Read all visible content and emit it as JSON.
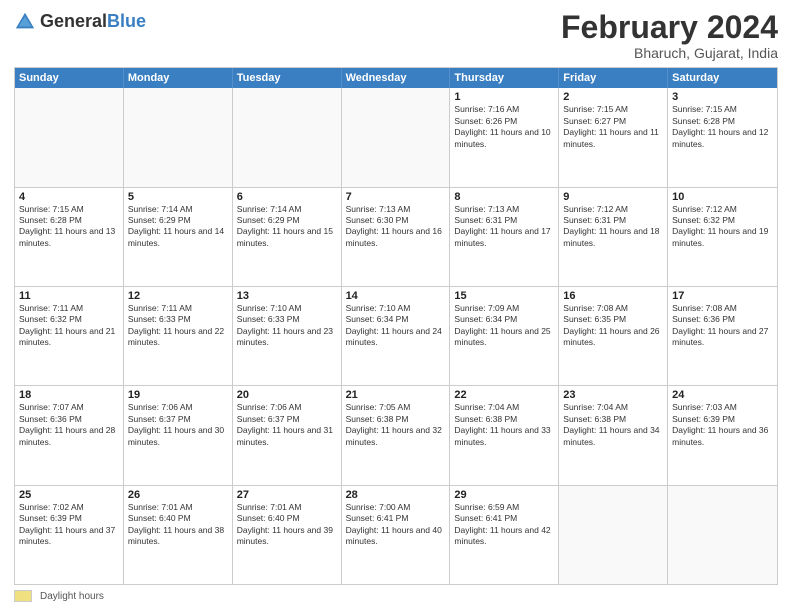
{
  "header": {
    "logo_general": "General",
    "logo_blue": "Blue",
    "month_year": "February 2024",
    "location": "Bharuch, Gujarat, India"
  },
  "calendar": {
    "days_of_week": [
      "Sunday",
      "Monday",
      "Tuesday",
      "Wednesday",
      "Thursday",
      "Friday",
      "Saturday"
    ],
    "footer_label": "Daylight hours",
    "weeks": [
      [
        {
          "day": "",
          "info": ""
        },
        {
          "day": "",
          "info": ""
        },
        {
          "day": "",
          "info": ""
        },
        {
          "day": "",
          "info": ""
        },
        {
          "day": "1",
          "info": "Sunrise: 7:16 AM\nSunset: 6:26 PM\nDaylight: 11 hours and 10 minutes."
        },
        {
          "day": "2",
          "info": "Sunrise: 7:15 AM\nSunset: 6:27 PM\nDaylight: 11 hours and 11 minutes."
        },
        {
          "day": "3",
          "info": "Sunrise: 7:15 AM\nSunset: 6:28 PM\nDaylight: 11 hours and 12 minutes."
        }
      ],
      [
        {
          "day": "4",
          "info": "Sunrise: 7:15 AM\nSunset: 6:28 PM\nDaylight: 11 hours and 13 minutes."
        },
        {
          "day": "5",
          "info": "Sunrise: 7:14 AM\nSunset: 6:29 PM\nDaylight: 11 hours and 14 minutes."
        },
        {
          "day": "6",
          "info": "Sunrise: 7:14 AM\nSunset: 6:29 PM\nDaylight: 11 hours and 15 minutes."
        },
        {
          "day": "7",
          "info": "Sunrise: 7:13 AM\nSunset: 6:30 PM\nDaylight: 11 hours and 16 minutes."
        },
        {
          "day": "8",
          "info": "Sunrise: 7:13 AM\nSunset: 6:31 PM\nDaylight: 11 hours and 17 minutes."
        },
        {
          "day": "9",
          "info": "Sunrise: 7:12 AM\nSunset: 6:31 PM\nDaylight: 11 hours and 18 minutes."
        },
        {
          "day": "10",
          "info": "Sunrise: 7:12 AM\nSunset: 6:32 PM\nDaylight: 11 hours and 19 minutes."
        }
      ],
      [
        {
          "day": "11",
          "info": "Sunrise: 7:11 AM\nSunset: 6:32 PM\nDaylight: 11 hours and 21 minutes."
        },
        {
          "day": "12",
          "info": "Sunrise: 7:11 AM\nSunset: 6:33 PM\nDaylight: 11 hours and 22 minutes."
        },
        {
          "day": "13",
          "info": "Sunrise: 7:10 AM\nSunset: 6:33 PM\nDaylight: 11 hours and 23 minutes."
        },
        {
          "day": "14",
          "info": "Sunrise: 7:10 AM\nSunset: 6:34 PM\nDaylight: 11 hours and 24 minutes."
        },
        {
          "day": "15",
          "info": "Sunrise: 7:09 AM\nSunset: 6:34 PM\nDaylight: 11 hours and 25 minutes."
        },
        {
          "day": "16",
          "info": "Sunrise: 7:08 AM\nSunset: 6:35 PM\nDaylight: 11 hours and 26 minutes."
        },
        {
          "day": "17",
          "info": "Sunrise: 7:08 AM\nSunset: 6:36 PM\nDaylight: 11 hours and 27 minutes."
        }
      ],
      [
        {
          "day": "18",
          "info": "Sunrise: 7:07 AM\nSunset: 6:36 PM\nDaylight: 11 hours and 28 minutes."
        },
        {
          "day": "19",
          "info": "Sunrise: 7:06 AM\nSunset: 6:37 PM\nDaylight: 11 hours and 30 minutes."
        },
        {
          "day": "20",
          "info": "Sunrise: 7:06 AM\nSunset: 6:37 PM\nDaylight: 11 hours and 31 minutes."
        },
        {
          "day": "21",
          "info": "Sunrise: 7:05 AM\nSunset: 6:38 PM\nDaylight: 11 hours and 32 minutes."
        },
        {
          "day": "22",
          "info": "Sunrise: 7:04 AM\nSunset: 6:38 PM\nDaylight: 11 hours and 33 minutes."
        },
        {
          "day": "23",
          "info": "Sunrise: 7:04 AM\nSunset: 6:38 PM\nDaylight: 11 hours and 34 minutes."
        },
        {
          "day": "24",
          "info": "Sunrise: 7:03 AM\nSunset: 6:39 PM\nDaylight: 11 hours and 36 minutes."
        }
      ],
      [
        {
          "day": "25",
          "info": "Sunrise: 7:02 AM\nSunset: 6:39 PM\nDaylight: 11 hours and 37 minutes."
        },
        {
          "day": "26",
          "info": "Sunrise: 7:01 AM\nSunset: 6:40 PM\nDaylight: 11 hours and 38 minutes."
        },
        {
          "day": "27",
          "info": "Sunrise: 7:01 AM\nSunset: 6:40 PM\nDaylight: 11 hours and 39 minutes."
        },
        {
          "day": "28",
          "info": "Sunrise: 7:00 AM\nSunset: 6:41 PM\nDaylight: 11 hours and 40 minutes."
        },
        {
          "day": "29",
          "info": "Sunrise: 6:59 AM\nSunset: 6:41 PM\nDaylight: 11 hours and 42 minutes."
        },
        {
          "day": "",
          "info": ""
        },
        {
          "day": "",
          "info": ""
        }
      ]
    ]
  }
}
